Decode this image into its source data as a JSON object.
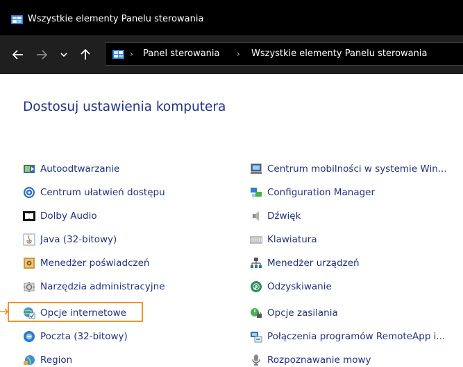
{
  "window": {
    "title": "Wszystkie elementy Panelu sterowania"
  },
  "navigation": {
    "back_icon": "arrow-left-icon",
    "forward_icon": "arrow-right-icon",
    "recent_icon": "chevron-down-icon",
    "up_icon": "arrow-up-icon",
    "breadcrumb": [
      "Panel sterowania",
      "Wszystkie elementy Panelu sterowania"
    ],
    "separator": "›"
  },
  "heading": "Dostosuj ustawienia komputera",
  "items_left": [
    {
      "label": "Autoodtwarzanie",
      "icon": "autoplay-icon"
    },
    {
      "label": "Centrum ułatwień dostępu",
      "icon": "ease-of-access-icon"
    },
    {
      "label": "Dolby Audio",
      "icon": "dolby-icon"
    },
    {
      "label": "Java (32-bitowy)",
      "icon": "java-icon"
    },
    {
      "label": "Menedżer poświadczeń",
      "icon": "credential-manager-icon"
    },
    {
      "label": "Narzędzia administracyjne",
      "icon": "admin-tools-icon"
    },
    {
      "label": "Opcje internetowe",
      "icon": "internet-options-icon"
    },
    {
      "label": "Poczta (32-bitowy)",
      "icon": "mail-icon"
    },
    {
      "label": "Region",
      "icon": "region-icon"
    }
  ],
  "items_right": [
    {
      "label": "Centrum mobilności w systemie Win...",
      "icon": "mobility-center-icon"
    },
    {
      "label": "Configuration Manager",
      "icon": "configuration-manager-icon"
    },
    {
      "label": "Dźwięk",
      "icon": "sound-icon"
    },
    {
      "label": "Klawiatura",
      "icon": "keyboard-icon"
    },
    {
      "label": "Menedżer urządzeń",
      "icon": "device-manager-icon"
    },
    {
      "label": "Odzyskiwanie",
      "icon": "recovery-icon"
    },
    {
      "label": "Opcje zasilania",
      "icon": "power-options-icon"
    },
    {
      "label": "Połączenia programów RemoteApp i...",
      "icon": "remoteapp-icon"
    },
    {
      "label": "Rozpoznawanie mowy",
      "icon": "speech-recognition-icon"
    }
  ],
  "highlighted_item": "Opcje internetowe",
  "colors": {
    "link": "#1e3287",
    "highlight": "#f0932b",
    "titlebar": "#000000",
    "navbar": "#1f1f1f"
  }
}
